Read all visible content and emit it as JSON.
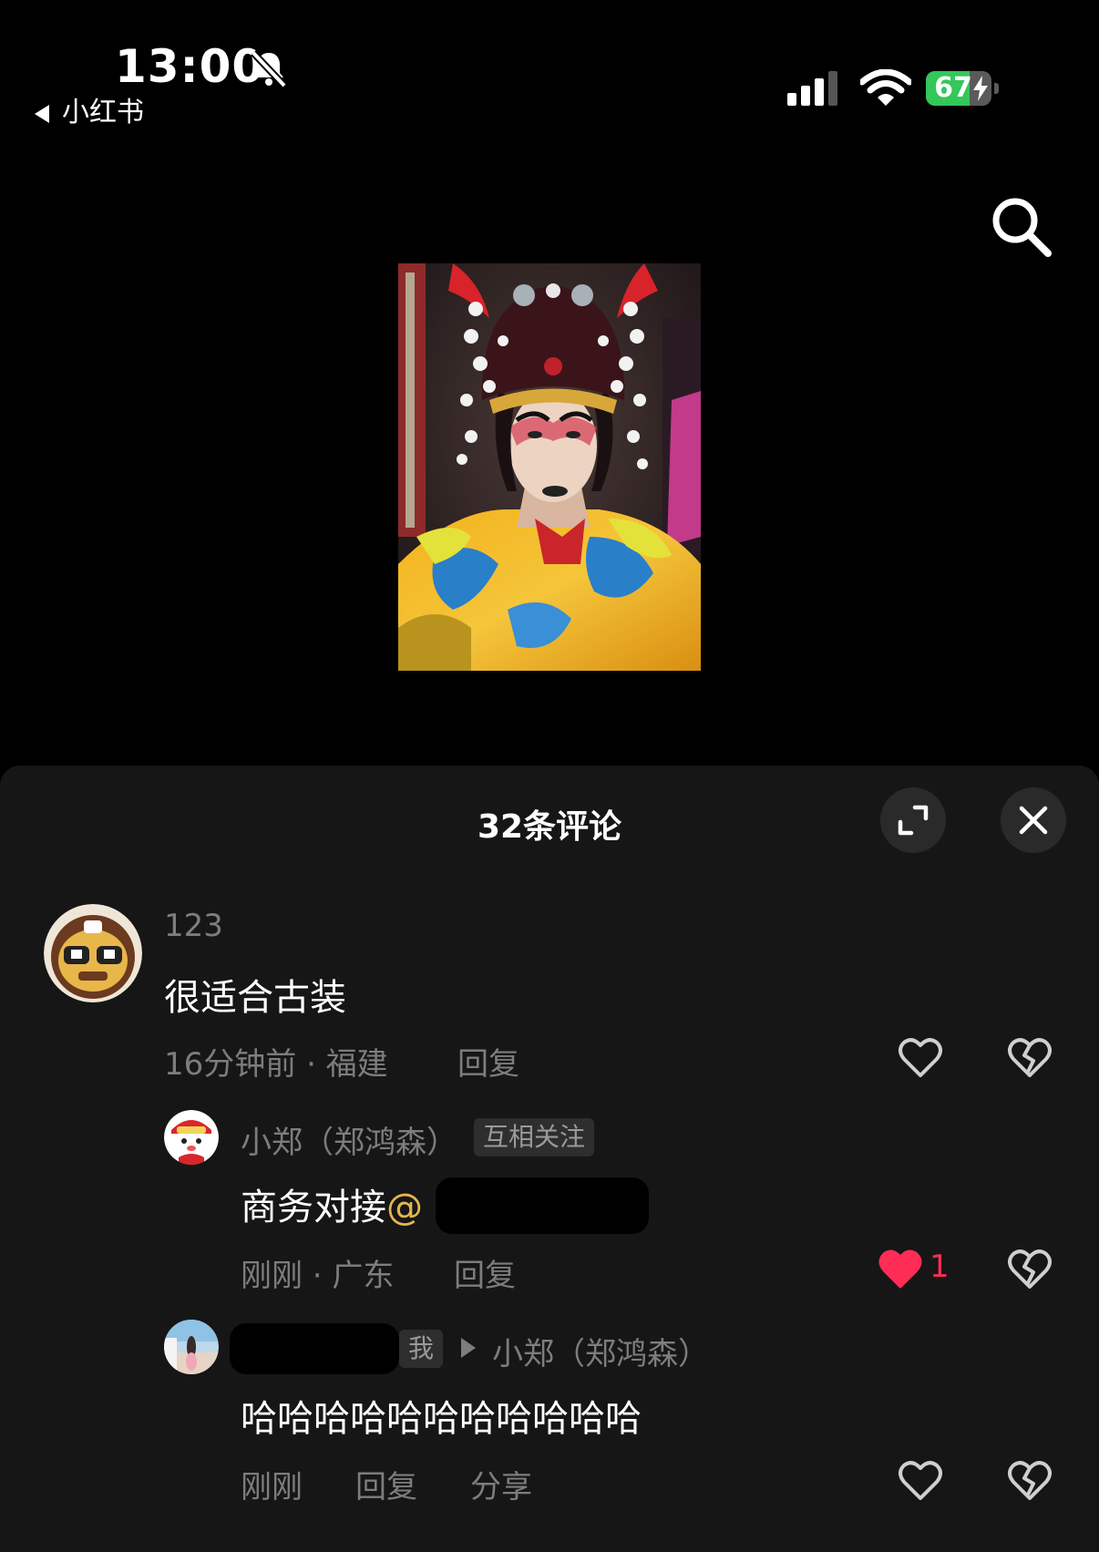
{
  "status": {
    "time": "13:00",
    "back_app": "小红书",
    "battery": "67",
    "battery_level": 0.67
  },
  "comments_header": {
    "title": "32条评论"
  },
  "icons": [
    "bell-slash-icon",
    "signal-icon",
    "wifi-icon",
    "battery-icon",
    "search-icon",
    "expand-icon",
    "close-icon",
    "heart-icon",
    "dislike-icon"
  ],
  "colors": {
    "like_red": "#ff2d55",
    "mention_gold": "#e5b64d",
    "battery_green": "#34c759"
  },
  "comments": [
    {
      "user": "123",
      "text": "很适合古装",
      "meta": "16分钟前 · 福建",
      "reply": "回复",
      "liked": false
    },
    {
      "user": "小郑（郑鸿森）",
      "badge": "互相关注",
      "text": "商务对接",
      "mention": "@",
      "meta": "刚刚 · 广东",
      "reply": "回复",
      "like_count": "1",
      "liked": true
    },
    {
      "badge": "我",
      "reply_to": "小郑（郑鸿森）",
      "text": "哈哈哈哈哈哈哈哈哈哈哈",
      "meta": "刚刚",
      "reply": "回复",
      "share": "分享",
      "liked": false
    }
  ]
}
